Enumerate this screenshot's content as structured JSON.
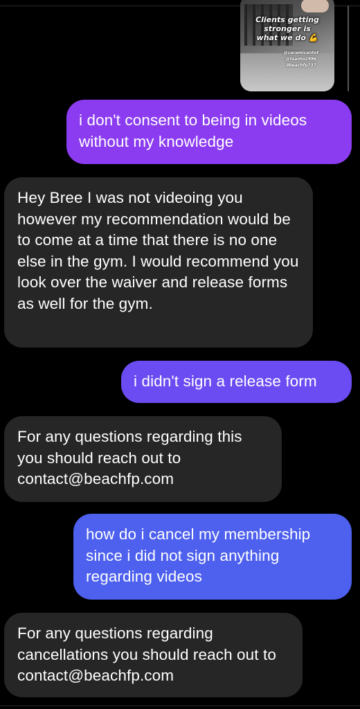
{
  "story_reply": {
    "caption": "Clients getting stronger is what we do",
    "caption_emoji": "💪",
    "tags": [
      "@ceramicantot",
      "@tsanto2996",
      "#beachfp737"
    ]
  },
  "messages": [
    {
      "id": "b1",
      "direction": "outgoing",
      "text": "i don't consent to being in videos without my knowledge",
      "color": "#8b3cf0"
    },
    {
      "id": "b2",
      "direction": "incoming",
      "text": "Hey Bree I was not videoing you however my recommendation would be to come at a time that there is no one else in the gym. I would recommend you look over the waiver and release forms as well for the gym.",
      "color": "#262626"
    },
    {
      "id": "b3",
      "direction": "outgoing",
      "text": "i didn't sign a release form",
      "color": "#6b4cf2"
    },
    {
      "id": "b4",
      "direction": "incoming",
      "text": "For any questions regarding this you should reach out to contact@beachfp.com",
      "color": "#262626"
    },
    {
      "id": "b5",
      "direction": "outgoing",
      "text": "how do i cancel my membership since i did not sign anything regarding videos",
      "color": "#4d60ee"
    },
    {
      "id": "b6",
      "direction": "incoming",
      "text": "For any questions regarding cancellations you should reach out to contact@beachfp.com",
      "color": "#262626"
    }
  ]
}
